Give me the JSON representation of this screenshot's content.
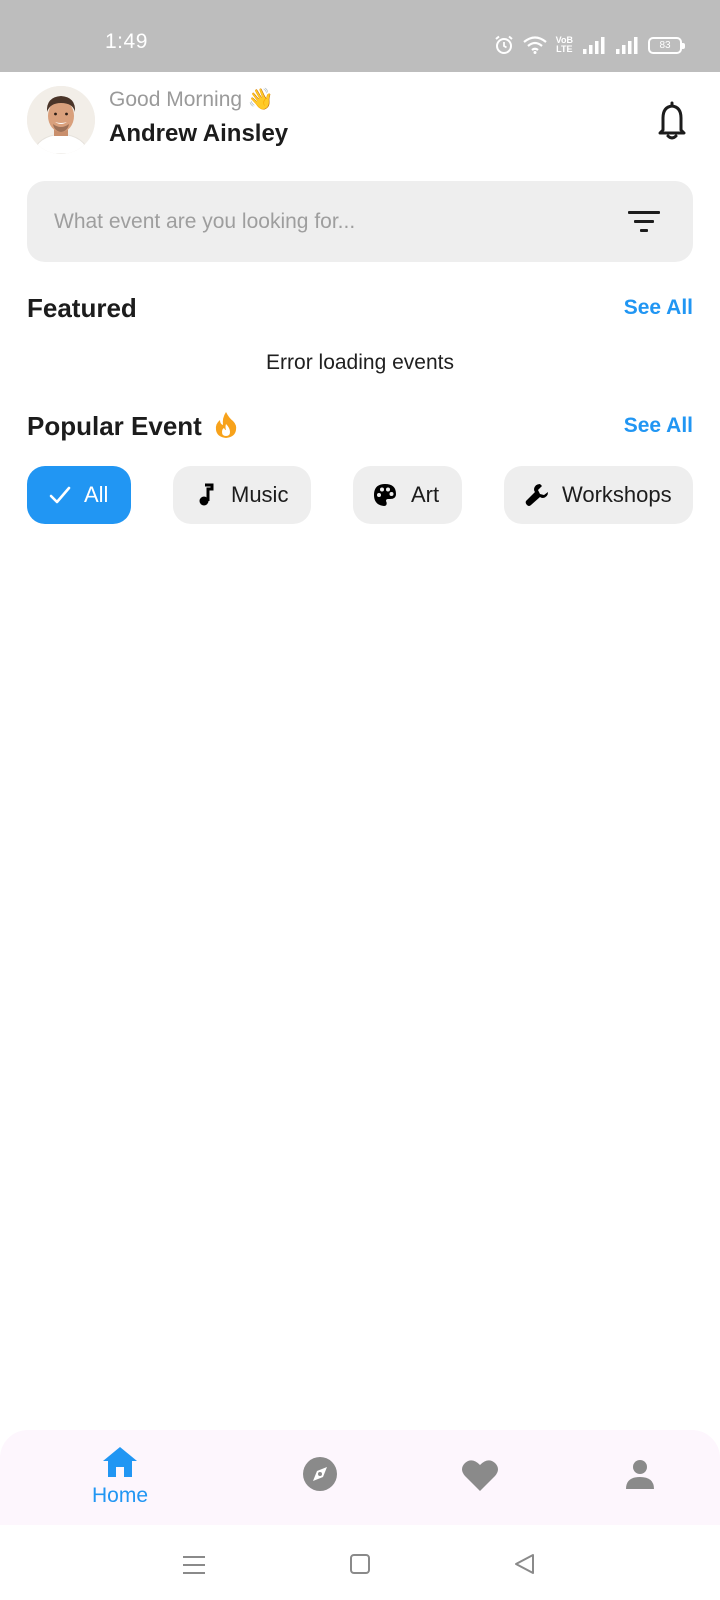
{
  "status_bar": {
    "time": "1:49",
    "battery_level": "83",
    "icons": [
      "alarm-icon",
      "wifi-icon",
      "volte-icon",
      "signal-icon",
      "signal-icon",
      "battery-icon"
    ],
    "volte_top": "VoB",
    "volte_bottom": "LTE"
  },
  "header": {
    "greeting": "Good Morning 👋",
    "user_name": "Andrew Ainsley"
  },
  "search": {
    "placeholder": "What event are you looking for..."
  },
  "featured": {
    "title": "Featured",
    "see_all": "See All",
    "message": "Error loading events"
  },
  "popular": {
    "title": "Popular Event",
    "see_all": "See All",
    "chips": [
      {
        "label": "All",
        "icon": "check-icon",
        "selected": true
      },
      {
        "label": "Music",
        "icon": "music-note-icon",
        "selected": false
      },
      {
        "label": "Art",
        "icon": "palette-icon",
        "selected": false
      },
      {
        "label": "Workshops",
        "icon": "wrench-icon",
        "selected": false
      }
    ]
  },
  "bottom_nav": {
    "items": [
      {
        "label": "Home",
        "icon": "home-icon",
        "active": true
      },
      {
        "label": "",
        "icon": "compass-icon",
        "active": false
      },
      {
        "label": "",
        "icon": "heart-icon",
        "active": false
      },
      {
        "label": "",
        "icon": "person-icon",
        "active": false
      }
    ]
  },
  "colors": {
    "accent": "#2196f3",
    "status_bar": "#bdbdbd",
    "chip_bg": "#eeeeee",
    "nav_bg": "#fdf6fd",
    "inactive_icon": "#8a8a8a",
    "fire": "#f7a21b"
  }
}
